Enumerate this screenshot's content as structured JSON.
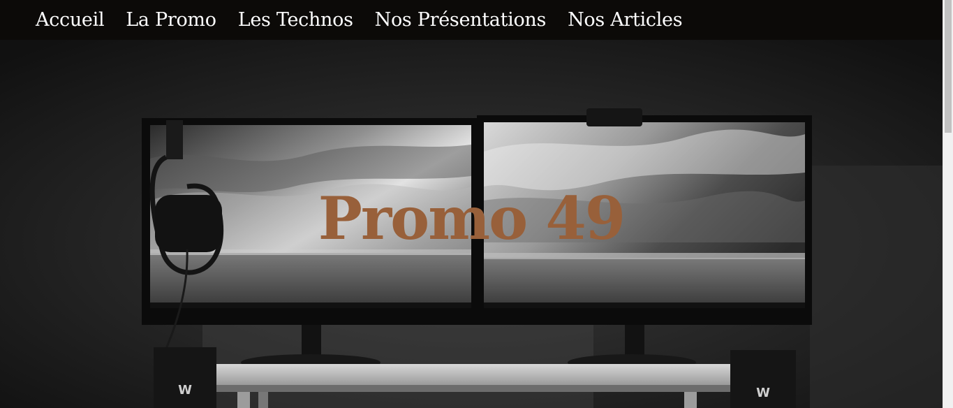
{
  "nav": {
    "items": [
      {
        "label": "Accueil"
      },
      {
        "label": "La Promo"
      },
      {
        "label": "Les Technos"
      },
      {
        "label": "Nos Présentations"
      },
      {
        "label": "Nos Articles"
      }
    ]
  },
  "hero": {
    "title": "Promo 49",
    "title_color": "#98603a",
    "background": "monitors-desk-photo"
  },
  "colors": {
    "navbar_bg": "#0c0a08",
    "nav_text": "#ffffff"
  }
}
